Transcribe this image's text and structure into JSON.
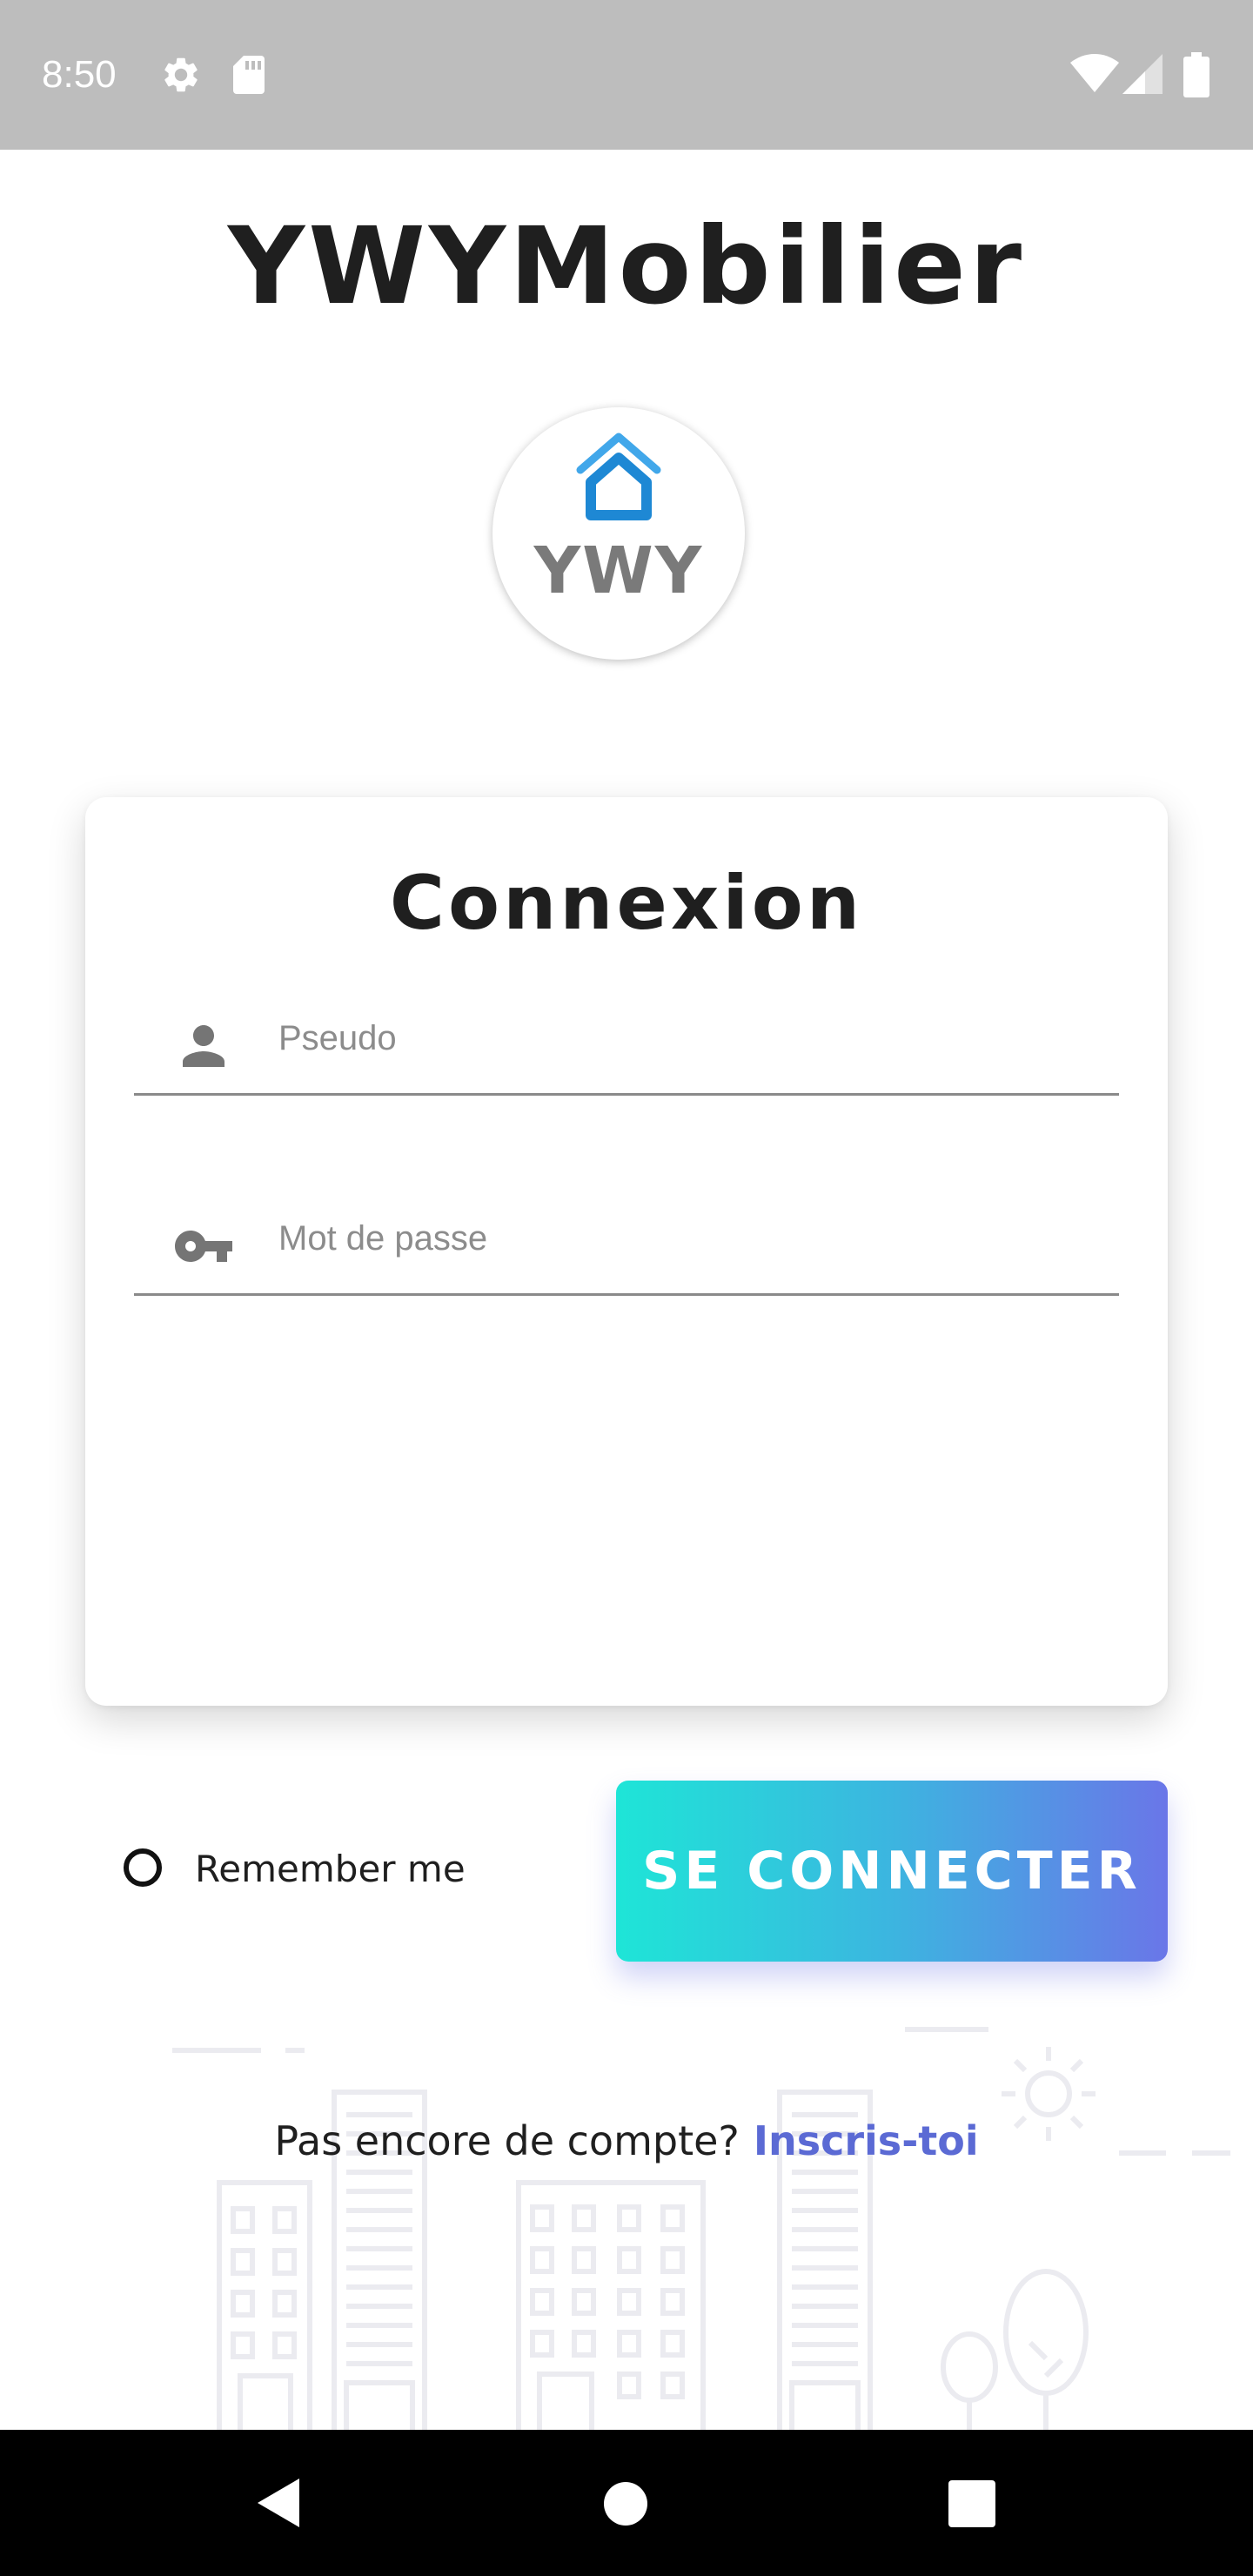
{
  "status_bar": {
    "time": "8:50",
    "left_icons": [
      "gear-icon",
      "sd-card-icon"
    ],
    "right_icons": [
      "wifi-icon",
      "signal-icon",
      "battery-icon"
    ]
  },
  "app": {
    "title": "YWYMobilier",
    "logo_text": "YWY"
  },
  "login_card": {
    "title": "Connexion",
    "username_field": {
      "icon": "person-icon",
      "placeholder": "Pseudo",
      "value": ""
    },
    "password_field": {
      "icon": "key-icon",
      "placeholder": "Mot de passe",
      "value": ""
    }
  },
  "remember_me": {
    "label": "Remember me",
    "checked": false
  },
  "login_button": {
    "label": "SE CONNECTER"
  },
  "signup": {
    "prompt": "Pas encore de compte?",
    "link": "Inscris-toi"
  },
  "colors": {
    "status_bar": "#bdbdbd",
    "logo_blue": "#2f8fdc",
    "button_gradient_start": "#1ee5d7",
    "button_gradient_end": "#6a76e8",
    "link": "#5b6ad4",
    "nav_bar": "#000000"
  },
  "nav_bar": {
    "buttons": [
      "back-icon",
      "home-icon",
      "recents-icon"
    ]
  }
}
